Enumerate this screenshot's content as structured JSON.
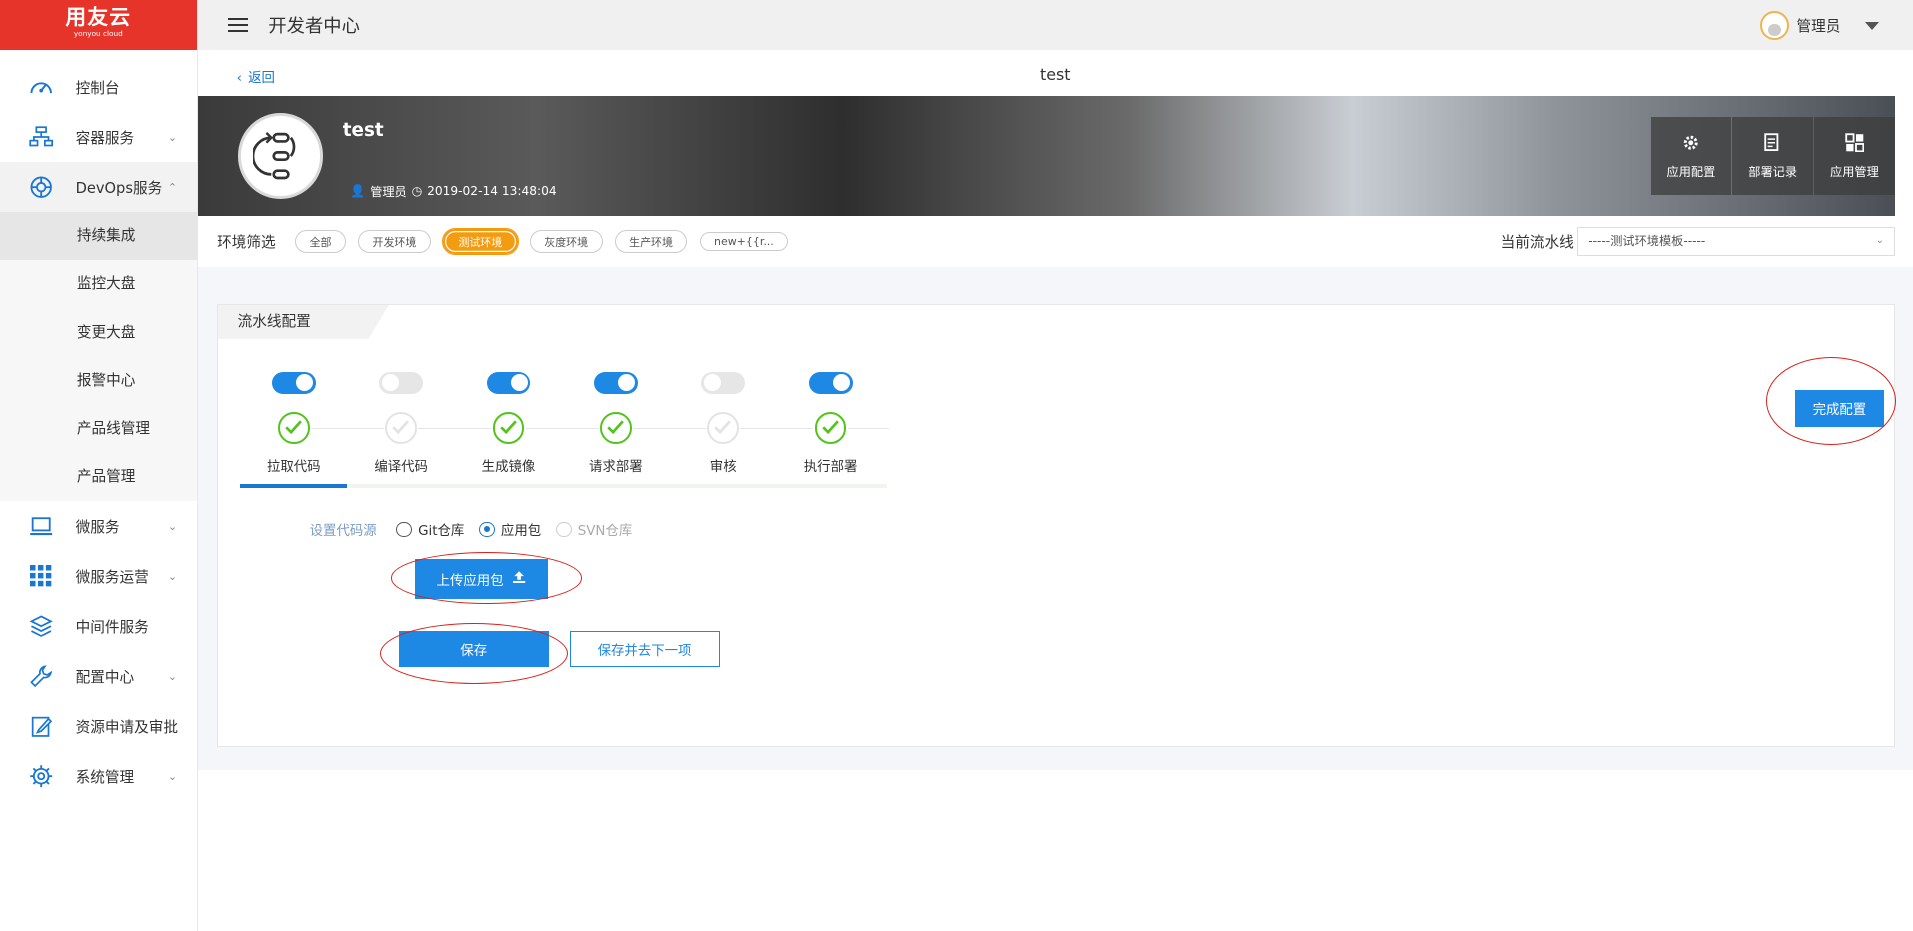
{
  "brand": {
    "name": "用友云",
    "sub": "yonyou cloud",
    "color": "#e7342b"
  },
  "topbar": {
    "title": "开发者中心",
    "user": "管理员"
  },
  "sidebar": {
    "items": [
      {
        "label": "控制台",
        "icon": "gauge-icon"
      },
      {
        "label": "容器服务",
        "icon": "network-icon",
        "chevron": "⌄"
      },
      {
        "label": "DevOps服务",
        "icon": "devops-icon",
        "chevron": "⌃"
      },
      {
        "label": "微服务",
        "icon": "laptop-icon",
        "chevron": "⌄"
      },
      {
        "label": "微服务运营",
        "icon": "grid-icon",
        "chevron": "⌄"
      },
      {
        "label": "中间件服务",
        "icon": "layers-icon"
      },
      {
        "label": "配置中心",
        "icon": "wrench-icon",
        "chevron": "⌄"
      },
      {
        "label": "资源申请及审批",
        "icon": "edit-doc-icon"
      },
      {
        "label": "系统管理",
        "icon": "gear-icon",
        "chevron": "⌄"
      }
    ],
    "subitems": [
      "持续集成",
      "监控大盘",
      "变更大盘",
      "报警中心",
      "产品线管理",
      "产品管理"
    ]
  },
  "subheader": {
    "back": "返回",
    "page_name": "test"
  },
  "app": {
    "name": "test",
    "owner": "管理员",
    "time": "2019-02-14 13:48:04"
  },
  "banner_actions": [
    "应用配置",
    "部署记录",
    "应用管理"
  ],
  "filter": {
    "label": "环境筛选",
    "chips": [
      "全部",
      "开发环境",
      "测试环境",
      "灰度环境",
      "生产环境",
      "new+{{r..."
    ],
    "active_index": 2,
    "pipeline_label": "当前流水线",
    "pipeline_value": "-----测试环境模板-----"
  },
  "card": {
    "tab": "流水线配置",
    "steps": [
      {
        "label": "拉取代码",
        "on": true
      },
      {
        "label": "编译代码",
        "on": false
      },
      {
        "label": "生成镜像",
        "on": true
      },
      {
        "label": "请求部署",
        "on": true
      },
      {
        "label": "审核",
        "on": false
      },
      {
        "label": "执行部署",
        "on": true
      }
    ],
    "source_label": "设置代码源",
    "sources": [
      "Git仓库",
      "应用包",
      "SVN仓库"
    ],
    "upload": "上传应用包",
    "save": "保存",
    "save_next": "保存并去下一项",
    "finish": "完成配置"
  }
}
